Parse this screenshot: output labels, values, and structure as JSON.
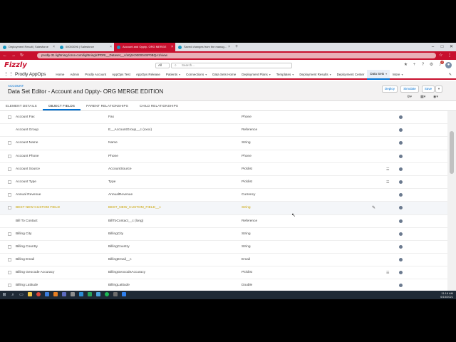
{
  "browser": {
    "tabs": [
      {
        "label": "Deployment Result | Salesforce",
        "active": false
      },
      {
        "label": "00003096 | Salesforce",
        "active": false
      },
      {
        "label": "Account and Oppty- ORG MERGE",
        "active": true
      },
      {
        "label": "Saved changes from the manag...",
        "active": false
      }
    ],
    "url": "prodly-31.lightning.force.com/lightning/r/PDRI__Dataset__c/a0j1K000004SP0BQA1/view"
  },
  "header": {
    "logo": "Fizzly",
    "search_scope": "All",
    "search_placeholder": "Search...",
    "notification_count": "1"
  },
  "nav": {
    "app_name": "Prodly AppOps",
    "items": [
      {
        "label": "Home",
        "dropdown": false,
        "active": false
      },
      {
        "label": "Admin",
        "dropdown": false,
        "active": false
      },
      {
        "label": "Prodly Account",
        "dropdown": false,
        "active": false
      },
      {
        "label": "AppOps Test",
        "dropdown": false,
        "active": false
      },
      {
        "label": "AppOps Release",
        "dropdown": false,
        "active": false
      },
      {
        "label": "Patients",
        "dropdown": true,
        "active": false
      },
      {
        "label": "Connections",
        "dropdown": true,
        "active": false
      },
      {
        "label": "Data Sets Home",
        "dropdown": false,
        "active": false
      },
      {
        "label": "Deployment Plans",
        "dropdown": true,
        "active": false
      },
      {
        "label": "Templates",
        "dropdown": true,
        "active": false
      },
      {
        "label": "Deployment Results",
        "dropdown": true,
        "active": false
      },
      {
        "label": "Deployment Center",
        "dropdown": false,
        "active": false
      },
      {
        "label": "Data Sets",
        "dropdown": true,
        "active": true
      },
      {
        "label": "More",
        "dropdown": true,
        "active": false
      }
    ]
  },
  "page": {
    "breadcrumb": "ACCOUNT",
    "title": "Data Set Editor - Account and Oppty- ORG MERGE EDITION",
    "buttons": {
      "deploy": "Deploy",
      "simulate": "Simulate",
      "save": "Save"
    }
  },
  "subtabs": [
    {
      "label": "ELEMENT DETAILS",
      "active": false
    },
    {
      "label": "OBJECT FIELDS",
      "active": true
    },
    {
      "label": "PARENT RELATIONSHIPS",
      "active": false
    },
    {
      "label": "CHILD RELATIONSHIPS",
      "active": false
    }
  ],
  "fields": [
    {
      "label": "Account Fax",
      "api": "Fax",
      "type": "Phone",
      "checkbox": true,
      "picklist": false,
      "highlight": false
    },
    {
      "label": "Account Group",
      "api": "E__AccountGroup__c (xxxx)",
      "type": "Reference",
      "checkbox": false,
      "picklist": false,
      "highlight": false
    },
    {
      "label": "Account Name",
      "api": "Name",
      "type": "String",
      "checkbox": true,
      "picklist": false,
      "highlight": false
    },
    {
      "label": "Account Phone",
      "api": "Phone",
      "type": "Phone",
      "checkbox": true,
      "picklist": false,
      "highlight": false
    },
    {
      "label": "Account Source",
      "api": "AccountSource",
      "type": "Picklist",
      "checkbox": true,
      "picklist": true,
      "highlight": false
    },
    {
      "label": "Account Type",
      "api": "Type",
      "type": "Picklist",
      "checkbox": true,
      "picklist": true,
      "highlight": false
    },
    {
      "label": "Annual Revenue",
      "api": "AnnualRevenue",
      "type": "Currency",
      "checkbox": true,
      "picklist": false,
      "highlight": false
    },
    {
      "label": "BEST NEW CUSTOM FIELD",
      "api": "BEST_NEW_CUSTOM_FIELD__c",
      "type": "String",
      "checkbox": true,
      "picklist": false,
      "highlight": true
    },
    {
      "label": "Bill To Contact",
      "api": "BillToContact__c (long)",
      "type": "Reference",
      "checkbox": false,
      "picklist": false,
      "highlight": false
    },
    {
      "label": "Billing City",
      "api": "BillingCity",
      "type": "String",
      "checkbox": true,
      "picklist": false,
      "highlight": false
    },
    {
      "label": "Billing Country",
      "api": "BillingCountry",
      "type": "String",
      "checkbox": true,
      "picklist": false,
      "highlight": false
    },
    {
      "label": "Billing Email",
      "api": "BillingEmail__c",
      "type": "Email",
      "checkbox": true,
      "picklist": false,
      "highlight": false
    },
    {
      "label": "Billing Geocode Accuracy",
      "api": "BillingGeocodeAccuracy",
      "type": "Picklist",
      "checkbox": true,
      "picklist": true,
      "highlight": false
    },
    {
      "label": "Billing Latitude",
      "api": "BillingLatitude",
      "type": "Double",
      "checkbox": true,
      "picklist": false,
      "highlight": false
    }
  ],
  "taskbar": {
    "time": "11:16 AM",
    "date": "6/15/2021"
  },
  "colors": {
    "brand": "#c8102e",
    "link": "#0070d2"
  }
}
